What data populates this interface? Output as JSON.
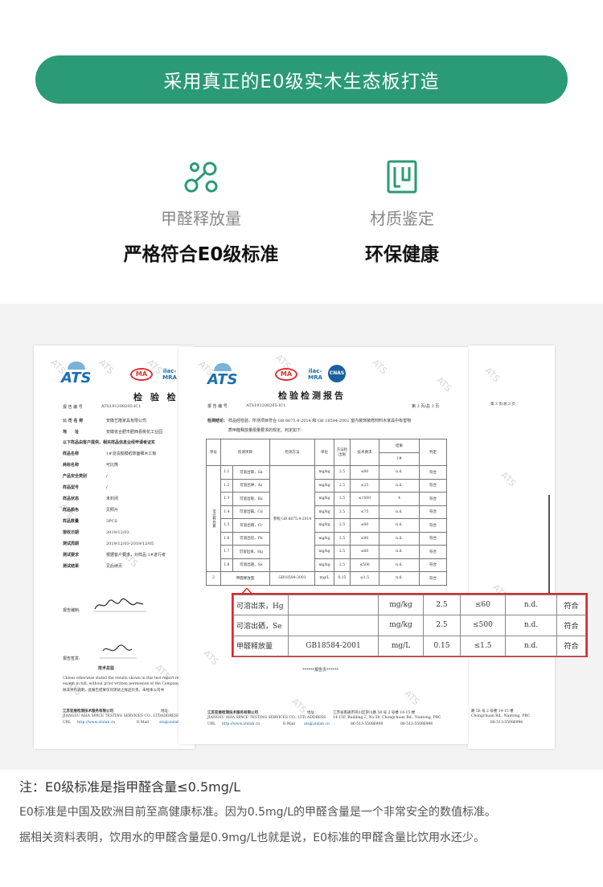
{
  "banner": {
    "text": "采用真正的E0级实木生态板打造"
  },
  "features": [
    {
      "icon": "molecule-icon",
      "label": "甲醛释放量",
      "title": "严格符合E0级标准"
    },
    {
      "icon": "wood-panel-icon",
      "label": "材质鉴定",
      "title": "环保健康"
    }
  ],
  "report": {
    "logo_text": "ATS",
    "ma_text": "MA",
    "ilac_text": "ilac-MRA",
    "cnas_text": "CNAS",
    "watermark": "ATS",
    "front": {
      "title": "检验检测报告",
      "report_no_label": "报 告 编 号",
      "report_no": "ATS191200205-IC1",
      "page": "第 2 页/总 3 页",
      "conclusion_label": "检测结论：",
      "conclusion": "样品经检验，所测项目符合 GB 6675.4-2014 和 GB 18584-2001 室内装饰装修材料木家具中有害物",
      "conclusion2": "质甲醛释放量限量要求的规定。判定如下：",
      "headers": [
        "序号",
        "检测项目",
        "检测方法",
        "单位",
        "方法检出限",
        "技术要求",
        "结果",
        "判定"
      ],
      "result_sub": "1#",
      "group_label": "可迁移元素",
      "method_main": "参照 GB 6675.4-2014",
      "rows": [
        {
          "no": "1.1",
          "item": "可溶出锑，Sb",
          "unit": "mg/kg",
          "limit": "2.5",
          "req": "≤60",
          "res": "n.d.",
          "judge": "符合"
        },
        {
          "no": "1.2",
          "item": "可溶出砷，As",
          "unit": "mg/kg",
          "limit": "2.5",
          "req": "≤25",
          "res": "n.d.",
          "judge": "符合"
        },
        {
          "no": "1.3",
          "item": "可溶出钡，Ba",
          "unit": "mg/kg",
          "limit": "2.5",
          "req": "≤1000",
          "res": "4",
          "judge": "符合"
        },
        {
          "no": "1.4",
          "item": "可溶出镉，Cd",
          "unit": "mg/kg",
          "limit": "2.5",
          "req": "≤75",
          "res": "n.d.",
          "judge": "符合"
        },
        {
          "no": "1.5",
          "item": "可溶出铬，Cr",
          "unit": "mg/kg",
          "limit": "2.5",
          "req": "≤60",
          "res": "n.d.",
          "judge": "符合"
        },
        {
          "no": "1.6",
          "item": "可溶出铅，Pb",
          "unit": "mg/kg",
          "limit": "2.5",
          "req": "≤90",
          "res": "n.d.",
          "judge": "符合"
        },
        {
          "no": "1.7",
          "item": "可溶出汞，Hg",
          "unit": "mg/kg",
          "limit": "2.5",
          "req": "≤60",
          "res": "n.d.",
          "judge": "符合"
        },
        {
          "no": "1.8",
          "item": "可溶出硒，Se",
          "unit": "mg/kg",
          "limit": "2.5",
          "req": "≤500",
          "res": "n.d.",
          "judge": "符合"
        }
      ],
      "row2": {
        "no": "2",
        "item": "甲醛释放量",
        "method": "GB18584-2001",
        "unit": "mg/L",
        "limit": "0.15",
        "req": "≤1.5",
        "res": "n.d.",
        "judge": "符合"
      },
      "end_text": "******报告页******",
      "footer_company": "江苏亚维检测技术服务有限公司",
      "footer_company_en": "JIANGSU ASIA SPACE TESTING SERVICES CO., LTD.",
      "footer_addr_label": "地址：",
      "footer_addr": "江苏省南通市崇川区崇川路 58 号 2 号楼 14-15 楼",
      "footer_addr_en": "14-15F, Building 2, No.58, Chongchuan Rd., Nantong, PRC",
      "footer_address_label": "ADDRESS",
      "footer_url_label": "URL",
      "footer_url": "http://www.atslab.cn",
      "footer_email_label": "E-Mail",
      "footer_email": "ats@atslab.cn",
      "footer_tel": "86-513-55086998",
      "footer_fax": "86-513-55086996"
    },
    "back_left": {
      "title": "检 验 检",
      "report_no_label": "报 告 编 号",
      "report_no": "ATS191200205-IC1",
      "fields": [
        {
          "k": "公 司 名 称",
          "v": "安徽艺隆家具有限公司"
        },
        {
          "k": "地　　址",
          "v": "安徽省合肥市肥西县桃花工业园"
        },
        {
          "k": "以下样品由客户提供，相关样品信息业经申请者证实",
          "v": ""
        },
        {
          "k": "样品名称",
          "v": "1#浸渍胶膜纸饰面细木工板"
        },
        {
          "k": "商标名称",
          "v": "可比熊"
        },
        {
          "k": "产品安全类别",
          "v": "/"
        },
        {
          "k": "样品型号",
          "v": "/"
        },
        {
          "k": "样品状态",
          "v": "未封闭"
        },
        {
          "k": "样品颜色",
          "v": "见照片"
        },
        {
          "k": "样品数量",
          "v": "3PCS"
        },
        {
          "k": "接收日期",
          "v": "2019/12/03"
        },
        {
          "k": "测试周期",
          "v": "2019/12/03-2019/12/05"
        },
        {
          "k": "测试要求",
          "v": "根据客户要求，对样品 1#进行考"
        },
        {
          "k": "测试结果",
          "v": "见后续页"
        }
      ],
      "signer_label": "报告编制:",
      "approver_label": "报告签发:",
      "approver_title": "技术总监",
      "note1": "Unless otherwise stated the results shown in this test report refer onl",
      "note2": "except in full, without prior written permission of the Company.",
      "note3": "除非另有说明，此报告结果仅对测试之样品负责。未经本公司书",
      "footer_company": "江苏亚维检测技术服务有限公司",
      "footer_company_en": "JIANGSU ASIA SPACE TESTING SERVICES CO., LTD.",
      "footer_addr_label": "地址：",
      "footer_address_label": "ADDRESS",
      "footer_url_label": "URL",
      "footer_url": "http://www.atslab.cn",
      "footer_email_label": "E-Mail",
      "footer_email": "ats@atslab.cn"
    },
    "back_right": {
      "page": "第 3 页/总 3 页",
      "footer1": "路 58 号 2 号楼 14-15 楼",
      "footer2": "Chongchuan Rd., Nantong, PRC",
      "footer3": "86-513-55086996"
    },
    "zoom": {
      "rows": [
        {
          "item": "可溶出汞，Hg",
          "method": "",
          "unit": "mg/kg",
          "limit": "2.5",
          "req": "≤60",
          "res": "n.d.",
          "judge": "符合"
        },
        {
          "item": "可溶出硒，Se",
          "method": "",
          "unit": "mg/kg",
          "limit": "2.5",
          "req": "≤500",
          "res": "n.d.",
          "judge": "符合"
        },
        {
          "item": "甲醛释放量",
          "method": "GB18584-2001",
          "unit": "mg/L",
          "limit": "0.15",
          "req": "≤1.5",
          "res": "n.d.",
          "judge": "符合"
        }
      ],
      "border_color": "#e0262a"
    }
  },
  "notes": {
    "line1": "注：E0级标准是指甲醛含量≤0.5mg/L",
    "line2": "E0标准是中国及欧洲目前至高健康标准。因为0.5mg/L的甲醛含量是一个非常安全的数值标准。",
    "line3": "据相关资料表明，饮用水的甲醛含量是0.9mg/L也就是说，E0标准的甲醛含量比饮用水还少。"
  },
  "colors": {
    "brand_green": "#2b9a76",
    "highlight_red": "#e0262a"
  }
}
